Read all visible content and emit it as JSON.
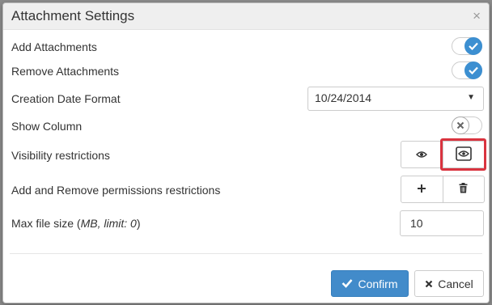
{
  "dialog": {
    "title": "Attachment Settings",
    "close_label": "×"
  },
  "rows": {
    "add_attachments": {
      "label": "Add Attachments",
      "enabled": true
    },
    "remove_attachments": {
      "label": "Remove Attachments",
      "enabled": true
    },
    "creation_date_format": {
      "label": "Creation Date Format",
      "selected": "10/24/2014"
    },
    "show_column": {
      "label": "Show Column",
      "enabled": false
    },
    "visibility_restrictions": {
      "label": "Visibility restrictions",
      "options": [
        "eye-icon",
        "eye-framed-icon"
      ]
    },
    "add_remove_permissions": {
      "label": "Add and Remove permissions restrictions",
      "options": [
        "plus-icon",
        "trash-icon"
      ]
    },
    "max_file_size": {
      "label_prefix": "Max file size (",
      "label_hint": "MB, limit: 0",
      "label_suffix": ")",
      "value": "10"
    }
  },
  "footer": {
    "confirm_label": "Confirm",
    "cancel_label": "Cancel"
  },
  "colors": {
    "accent": "#428bca",
    "toggle_on": "#3c8fd1",
    "highlight": "#d9333f"
  }
}
